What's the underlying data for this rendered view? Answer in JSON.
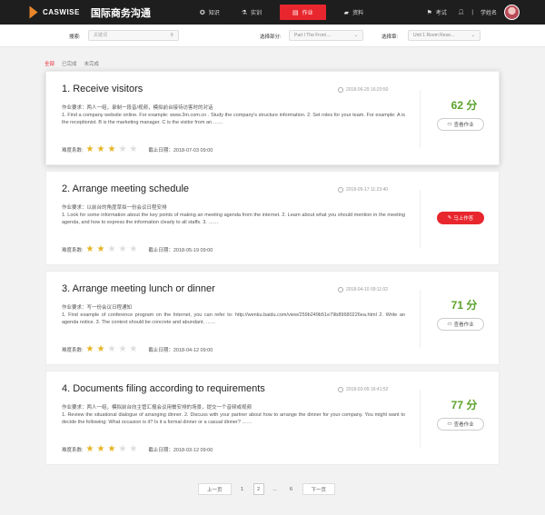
{
  "header": {
    "logo_text": "CASWISE",
    "brand": "国际商务沟通",
    "nav": [
      {
        "label": "知识",
        "icon": "compass-icon"
      },
      {
        "label": "实训",
        "icon": "flask-icon"
      },
      {
        "label": "作业",
        "icon": "document-icon",
        "active": true
      },
      {
        "label": "资料",
        "icon": "folder-icon"
      },
      {
        "label": "考试",
        "icon": "flag-icon"
      }
    ],
    "user_icon": "person-icon",
    "separator": "|",
    "user_name": "学姓名",
    "colors": {
      "bar": "#1e1e1e",
      "accent": "#e8262e",
      "logo": "#e8862a"
    }
  },
  "filters": {
    "search_label": "搜索:",
    "search_placeholder": "关键词",
    "section_label": "选择部分:",
    "section_value": "Part I The Front ...",
    "chapter_label": "选择章:",
    "chapter_value": "Unit 1 Room Rese..."
  },
  "tabs": [
    "全部",
    "已完成",
    "未完成"
  ],
  "cards": [
    {
      "title": "1. Receive visitors",
      "time": "2018-06-29 16:20:50",
      "requirement": "作业要求：两人一组，录制一段音/视频，模拟前台接待访客时的对话",
      "description": "1. Find a company website online. For example: www.3m.com.cn . Study the company's structure information.    2. Set roles for your team. For example: A is the receptionist. B is the marketing manager. C is the visitor from an ……",
      "difficulty_label": "难度系数:",
      "stars": 3,
      "deadline": "截止日期：2018-07-03 09:00",
      "score": "62 分",
      "action": "查看作业"
    },
    {
      "title": "2. Arrange meeting schedule",
      "time": "2018-05-17 11:23:40",
      "requirement": "作业要求：以前台的角度草拟一份会议日程安排",
      "description": "1. Look for some information about the key points of making an meeting agenda from the internet.    2. Learn about what you should mention in the meeting agenda, and how to express the information clearly to all staffs.  3. ……",
      "difficulty_label": "难度系数:",
      "stars": 2,
      "deadline": "截止日期：2018-05-19 09:00",
      "action": "马上作答"
    },
    {
      "title": "3. Arrange meeting lunch or dinner",
      "time": "2018-04-10 09:11:02",
      "requirement": "作业要求：写一份会议日程通知",
      "description": "1. Find example of conference program on the Internet, you can refer to: http://wenku.baidu.com/view/259b249b51e79b89680226ea.html    2. Write an agenda notice.    3. The context should be concrete and abundant. ……",
      "difficulty_label": "难度系数:",
      "stars": 2,
      "deadline": "截止日期：2018-04-12 09:00",
      "score": "71 分",
      "action": "查看作业"
    },
    {
      "title": "4. Documents filing according to requirements",
      "time": "2018-03-09 16:41:52",
      "requirement": "作业要求：两人一组，模拟前台向主管汇报会议用餐安排的场景，提交一个音频或视频",
      "description": "1. Review the situational dialogue of arranging dinner.    2. Discuss with your partner about how to arrange the dinner for your company. You might want to decide the following:   What occasion is it? Is it a formal dinner or a casual dinner? ……",
      "difficulty_label": "难度系数:",
      "stars": 3,
      "deadline": "截止日期：2018-03-12 09:00",
      "score": "77 分",
      "action": "查看作业"
    }
  ],
  "pagination": {
    "prev": "上一页",
    "pages": [
      "1",
      "2",
      "...",
      "6"
    ],
    "current": "2",
    "next": "下一页"
  }
}
